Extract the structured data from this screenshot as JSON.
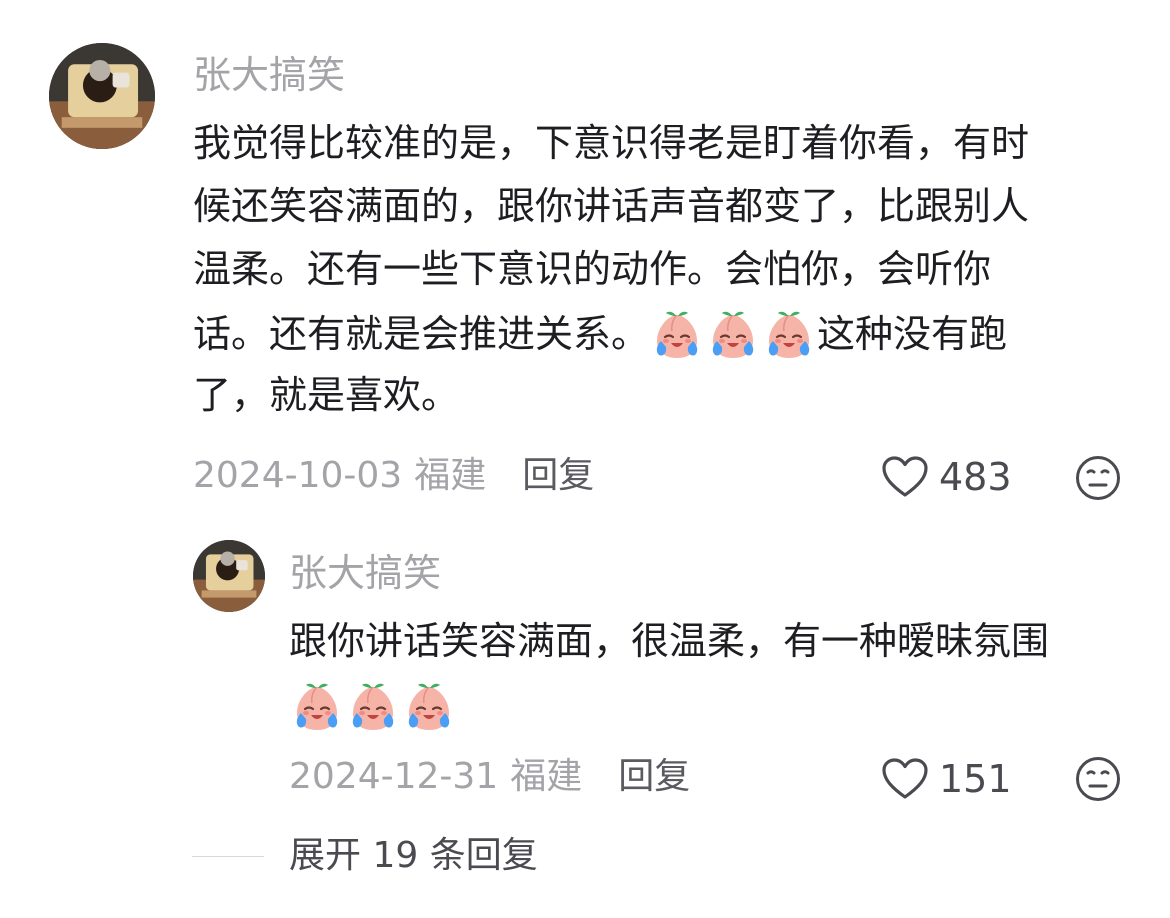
{
  "comment": {
    "username": "张大搞笑",
    "text_lines": [
      "我觉得比较准的是，下意识得老是盯着你看，有时",
      "候还笑容满面的，跟你讲话声音都变了，比跟别人",
      "温柔。还有一些下意识的动作。会怕你，会听你",
      "话。还有就是会推进关系。",
      "这种没有跑",
      "了，就是喜欢。"
    ],
    "date": "2024-10-03",
    "location": "福建",
    "reply_label": "回复",
    "like_count": "483"
  },
  "reply": {
    "username": "张大搞笑",
    "text_lines": [
      "跟你讲话笑容满面，很温柔，有一种暧昧氛围"
    ],
    "date": "2024-12-31",
    "location": "福建",
    "reply_label": "回复",
    "like_count": "151"
  },
  "expand_label": "展开 19 条回复",
  "icons": {
    "like": "heart-outline-icon",
    "dislike": "neutral-face-icon",
    "emoji": "crying-peach-emoji"
  },
  "colors": {
    "username": "#a3a3a8",
    "text": "#1e1e22",
    "meta": "#a3a3a8"
  }
}
